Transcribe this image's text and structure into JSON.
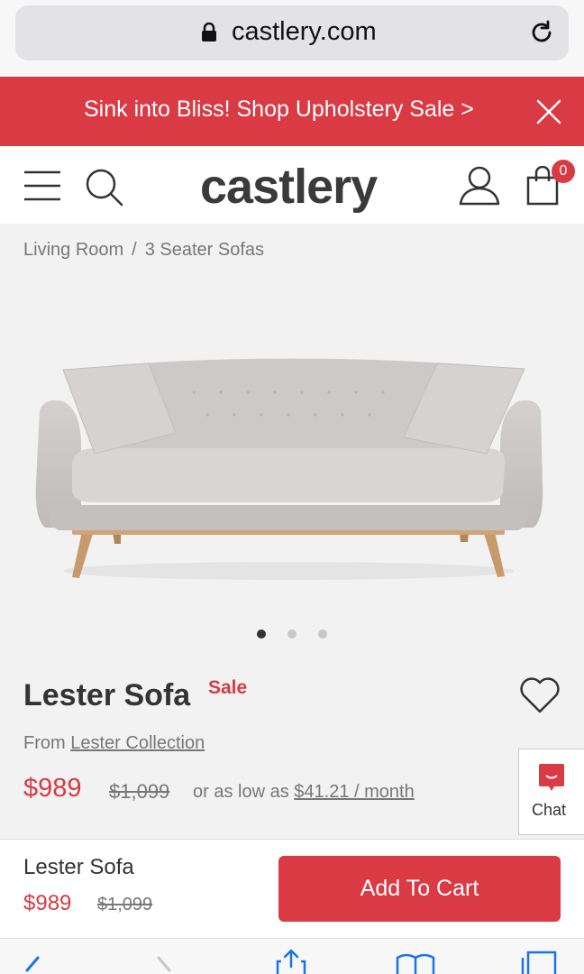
{
  "browser": {
    "url": "castlery.com"
  },
  "promo": {
    "text": "Sink into Bliss! Shop Upholstery Sale >"
  },
  "header": {
    "logo": "castlery",
    "cart_count": "0"
  },
  "breadcrumb": {
    "items": [
      "Living Room",
      "3 Seater Sofas"
    ],
    "separator": "/"
  },
  "gallery": {
    "dot_count": 3,
    "active_index": 0
  },
  "product": {
    "name": "Lester Sofa",
    "sale_label": "Sale",
    "from_prefix": "From",
    "collection": "Lester Collection",
    "price": "$989",
    "old_price": "$1,099",
    "installment_prefix": "or as low as",
    "installment": "$41.21 / month"
  },
  "chat": {
    "label": "Chat"
  },
  "sticky": {
    "name": "Lester Sofa",
    "price": "$989",
    "old_price": "$1,099",
    "button": "Add To Cart"
  },
  "colors": {
    "accent": "#d93a43",
    "link": "#1a73e8"
  }
}
